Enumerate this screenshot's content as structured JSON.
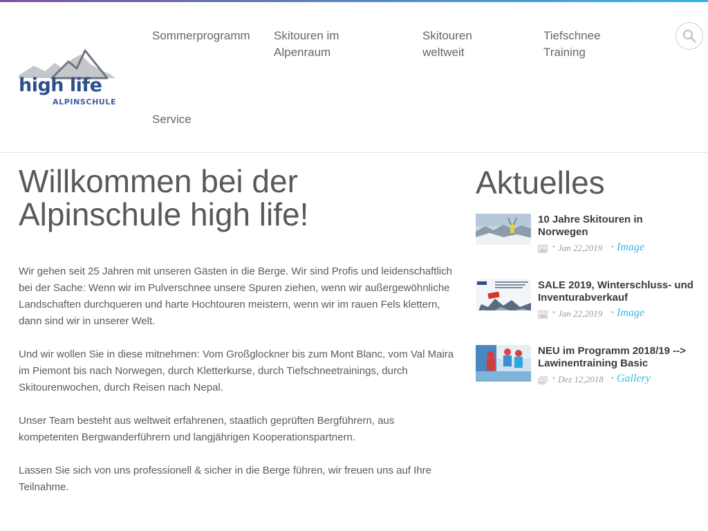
{
  "brand": {
    "logo_main": "high life",
    "logo_sub": "ALPINSCHULE"
  },
  "nav": [
    {
      "lines": [
        "Sommerprogramm"
      ]
    },
    {
      "lines": [
        "Skitouren im",
        "Alpenraum"
      ]
    },
    {
      "lines": [
        "Skitouren",
        "weltweit"
      ]
    },
    {
      "lines": [
        "Tiefschnee",
        "Training"
      ]
    },
    {
      "lines": [
        "Service"
      ]
    }
  ],
  "search": {
    "icon": "search-icon"
  },
  "main": {
    "title_line1": "Willkommen bei der",
    "title_line2": "Alpinschule high life!",
    "paragraphs": [
      "Wir gehen seit 25 Jahren mit unseren Gästen in die Berge. Wir sind Profis und leidenschaftlich bei der Sache: Wenn wir im Pulverschnee unsere Spuren ziehen, wenn wir außergewöhnliche Landschaften durchqueren und harte Hochtouren meistern, wenn wir im rauen Fels klettern, dann sind wir in unserer Welt.",
      "Und wir wollen Sie in diese mitnehmen: Vom Großglockner bis zum Mont Blanc, vom Val Maira im Piemont bis nach Norwegen, durch Kletterkurse, durch Tiefschneetrainings, durch Skitourenwochen, durch Reisen nach Nepal.",
      "Unser Team besteht aus weltweit erfahrenen, staatlich geprüften Bergführern, aus kompetenten Bergwanderführern und langjährigen Kooperationspartnern.",
      "Lassen Sie sich von uns professionell & sicher in die Berge führen, wir freuen uns auf Ihre Teilnahme."
    ]
  },
  "sidebar": {
    "title": "Aktuelles",
    "news": [
      {
        "title": "10 Jahre Skitouren in Norwegen",
        "date": "Jan 22,2019",
        "type": "Image",
        "icon": "image-icon"
      },
      {
        "title": "SALE 2019, Winterschluss- und Inventurabverkauf",
        "date": "Jan 22,2019",
        "type": "Image",
        "icon": "image-icon"
      },
      {
        "title": "NEU im Programm 2018/19 --> Lawinentraining Basic",
        "date": "Dez 12,2018",
        "type": "Gallery",
        "icon": "gallery-icon"
      }
    ]
  },
  "colors": {
    "accent": "#35b6e4",
    "logo_blue": "#2d4f8c",
    "text": "#5a5a5a"
  }
}
